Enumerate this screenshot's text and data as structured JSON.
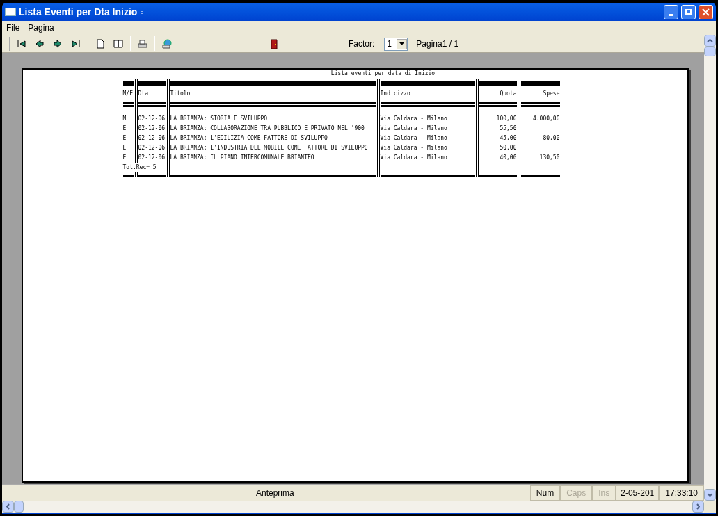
{
  "window": {
    "title": "Lista Eventi per Dta Inizio",
    "marker": "▫"
  },
  "menu": [
    "File",
    "Pagina"
  ],
  "toolbar": {
    "factor_label": "Factor:",
    "factor_value": "1",
    "page_label": "Pagina1 / 1"
  },
  "report": {
    "title": "Lista eventi per data di Inizio",
    "columns": [
      "M/E",
      "Dta",
      "Titolo",
      "Indicizzo",
      "Quota",
      "Spese"
    ],
    "rows": [
      {
        "type": "M",
        "date": "02-12-06",
        "title": "LA BRIANZA: STORIA E SVILUPPO",
        "address": "Via Caldara - Milano",
        "quota": "100,00",
        "spese": "4.000,00"
      },
      {
        "type": "E",
        "date": "02-12-06",
        "title": "LA BRIANZA: COLLABORAZIONE TRA PUBBLICO E PRIVATO NEL '900",
        "address": "Via Caldara - Milano",
        "quota": "55,50",
        "spese": ""
      },
      {
        "type": "E",
        "date": "02-12-06",
        "title": "LA BRIANZA: L'EDILIZIA COME FATTORE DI SVILUPPO",
        "address": "Via Caldara - Milano",
        "quota": "45,00",
        "spese": "80,00"
      },
      {
        "type": "E",
        "date": "02-12-06",
        "title": "LA BRIANZA: L'INDUSTRIA DEL MOBILE COME FATTORE DI SVILUPPO",
        "address": "Via Caldara - Milano",
        "quota": "50.00",
        "spese": ""
      },
      {
        "type": "E",
        "date": "02-12-06",
        "title": "LA BRIANZA: IL PIANO INTERCOMUNALE BRIANTEO",
        "address": "Via Caldara - Milano",
        "quota": "40,00",
        "spese": "130,50"
      }
    ],
    "total": "Tot.Rec= 5"
  },
  "status_bar": {
    "text": "Anteprima",
    "indicators": [
      {
        "label": "Num",
        "disabled": false
      },
      {
        "label": "Caps",
        "disabled": true
      },
      {
        "label": "Ins",
        "disabled": true
      }
    ],
    "date": "2-05-201",
    "time": "17:33:10"
  }
}
